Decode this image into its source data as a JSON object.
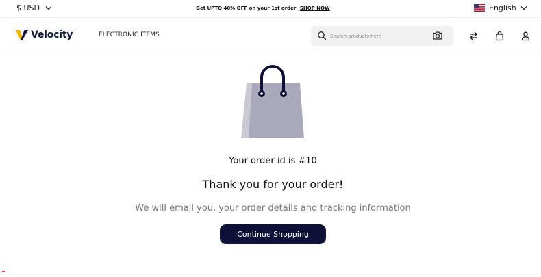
{
  "topbar": {
    "currency": "$ USD",
    "promo_text": "Get UPTO 40% OFF on your 1st order",
    "promo_link": "SHOP NOW",
    "language": "English",
    "flag_icon": "us-flag-icon"
  },
  "header": {
    "logo_text": "Velocity",
    "nav_link": "ELECTRONIC ITEMS",
    "search_placeholder": "Search products here",
    "icons": [
      "search-icon",
      "camera-icon",
      "compare-arrows-icon",
      "shopping-bag-icon",
      "user-icon"
    ]
  },
  "confirmation": {
    "illustration": "shopping-bag-icon",
    "order_id_text": "Your order id is #10",
    "heading": "Thank you for your order!",
    "message": "We will email you, your order details and tracking information",
    "button_label": "Continue Shopping"
  },
  "colors": {
    "navy": "#0d1137",
    "logo_navy": "#0f1b3d",
    "logo_gold": "#f5b400",
    "bag_gray": "#a9a9bb",
    "muted_text": "#777777",
    "search_bg": "#f1f1f1"
  }
}
